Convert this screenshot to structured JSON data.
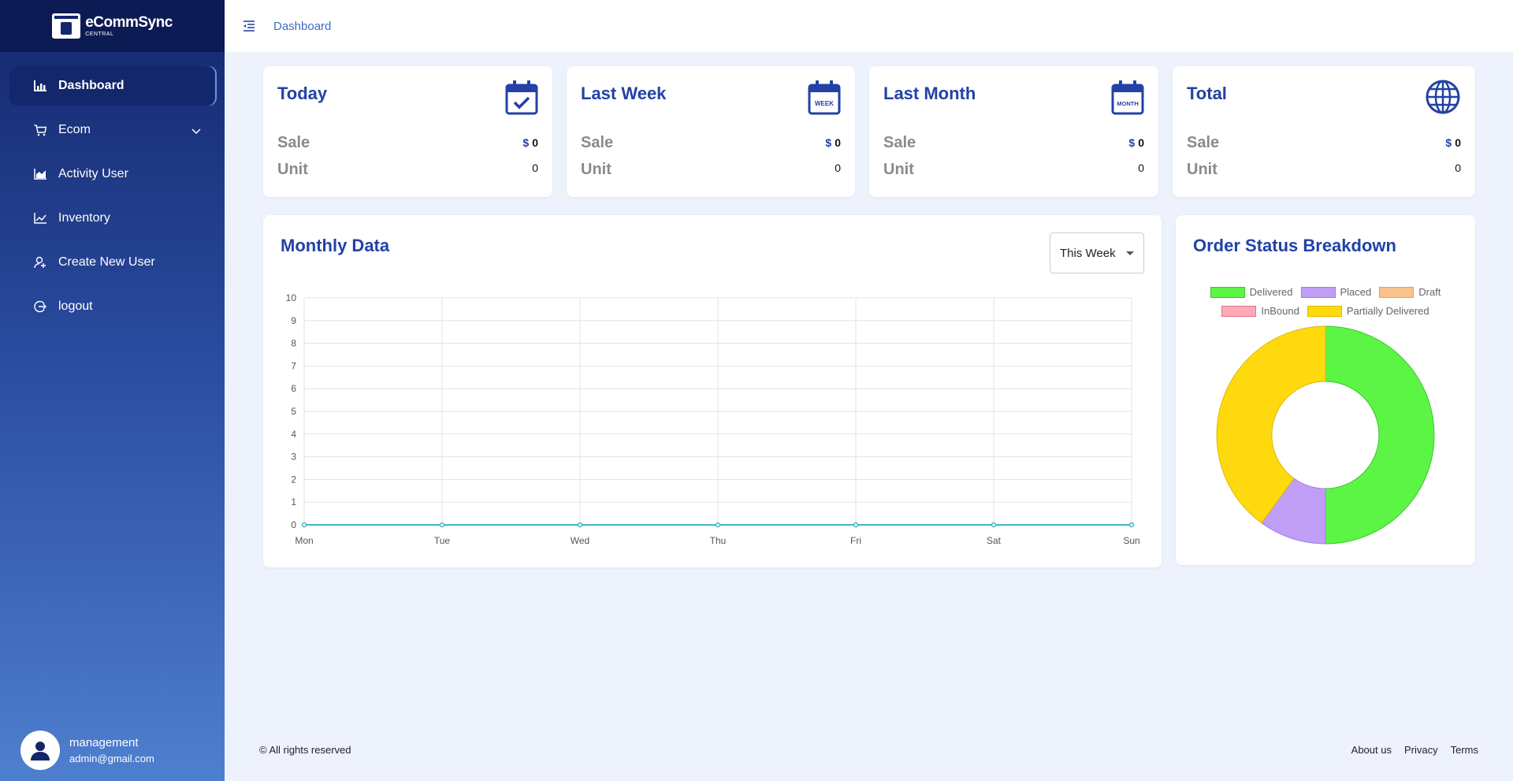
{
  "brand": {
    "name": "eCommSync",
    "subtitle": "CENTRAL"
  },
  "sidebar": {
    "items": [
      {
        "label": "Dashboard",
        "icon": "chart-bar-icon",
        "active": true
      },
      {
        "label": "Ecom",
        "icon": "cart-icon"
      },
      {
        "label": "Activity User",
        "icon": "chart-area-icon"
      },
      {
        "label": "Inventory",
        "icon": "chart-line-icon"
      },
      {
        "label": "Create New User",
        "icon": "user-add-icon"
      },
      {
        "label": "logout",
        "icon": "logout-icon"
      }
    ]
  },
  "profile": {
    "name": "management",
    "email": "admin@gmail.com"
  },
  "topbar": {
    "breadcrumb": "Dashboard"
  },
  "stats": [
    {
      "title": "Today",
      "icon": "calendar-check-icon",
      "sale_label": "Sale",
      "sale_currency": "$",
      "sale_value": "0",
      "unit_label": "Unit",
      "unit_value": "0"
    },
    {
      "title": "Last Week",
      "icon": "calendar-week-icon",
      "icon_text": "WEEK",
      "sale_label": "Sale",
      "sale_currency": "$",
      "sale_value": "0",
      "unit_label": "Unit",
      "unit_value": "0"
    },
    {
      "title": "Last Month",
      "icon": "calendar-month-icon",
      "icon_text": "MONTH",
      "sale_label": "Sale",
      "sale_currency": "$",
      "sale_value": "0",
      "unit_label": "Unit",
      "unit_value": "0"
    },
    {
      "title": "Total",
      "icon": "globe-icon",
      "sale_label": "Sale",
      "sale_currency": "$",
      "sale_value": "0",
      "unit_label": "Unit",
      "unit_value": "0"
    }
  ],
  "monthly": {
    "title": "Monthly Data",
    "filter": "This Week"
  },
  "order_status": {
    "title": "Order Status Breakdown"
  },
  "chart_data": [
    {
      "type": "line",
      "title": "Monthly Data",
      "categories": [
        "Mon",
        "Tue",
        "Wed",
        "Thu",
        "Fri",
        "Sat",
        "Sun"
      ],
      "yticks": [
        "0",
        "1",
        "2",
        "3",
        "4",
        "5",
        "6",
        "7",
        "8",
        "9",
        "10"
      ],
      "series": [
        {
          "values": [
            0,
            0,
            0,
            0,
            0,
            0,
            0
          ],
          "color": "#3fb6c9"
        }
      ],
      "ylim": [
        0,
        10
      ],
      "grid": true
    },
    {
      "type": "pie",
      "title": "Order Status Breakdown",
      "donut": true,
      "legend_position": "top",
      "labels": [
        "Delivered",
        "Placed",
        "Draft",
        "InBound",
        "Partially Delivered"
      ],
      "values": [
        50,
        10,
        0,
        0,
        40
      ],
      "colors": [
        "#5cf545",
        "#c09ef6",
        "#fbc18a",
        "#fea8b8",
        "#fed90e"
      ],
      "borders": [
        "#39c52a",
        "#9e7fe0",
        "#e99f5f",
        "#e0778d",
        "#e0b800"
      ]
    }
  ],
  "footer": {
    "copyright": "© All rights reserved",
    "links": [
      "About us",
      "Privacy",
      "Terms"
    ]
  },
  "colors": {
    "accent": "#2341a6",
    "sidebar_dark": "#13276c",
    "page_bg": "#edf2fc"
  }
}
